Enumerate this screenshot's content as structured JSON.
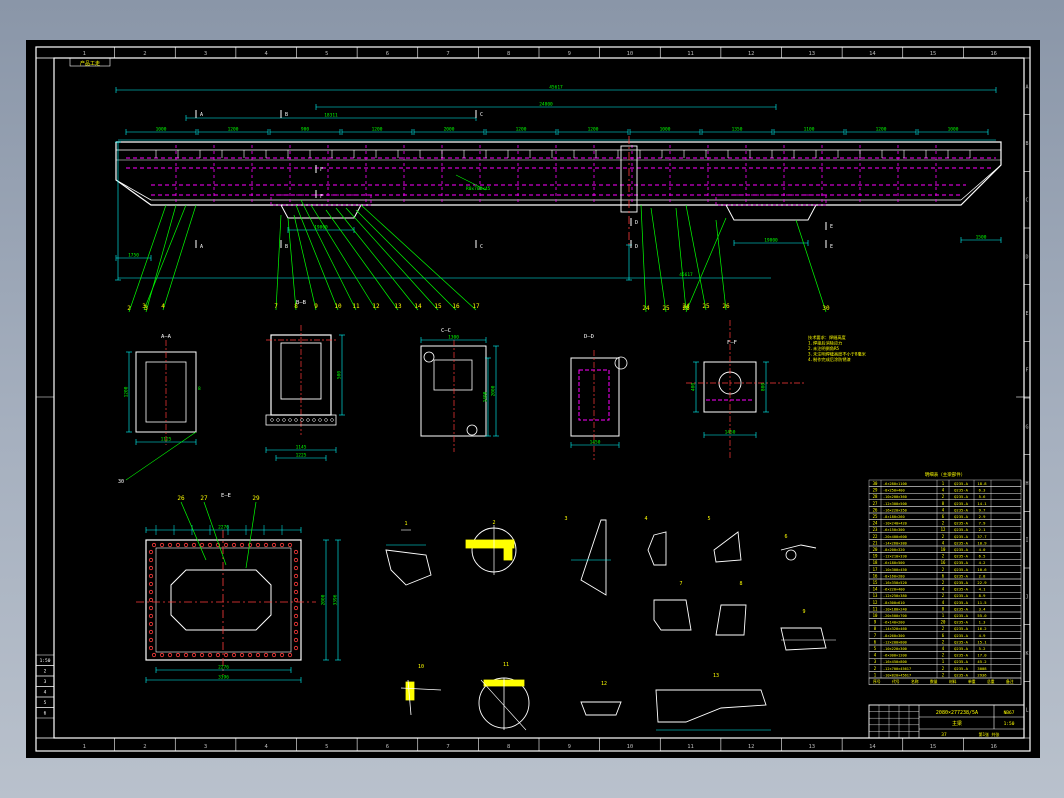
{
  "border": {
    "columns": [
      "1",
      "2",
      "3",
      "4",
      "5",
      "6",
      "7",
      "8",
      "9",
      "10",
      "11",
      "12",
      "13",
      "14",
      "15",
      "16"
    ],
    "rows": [
      "A",
      "B",
      "C",
      "D",
      "E",
      "F",
      "G",
      "H",
      "I",
      "J",
      "K",
      "L"
    ],
    "corner_tag": "产品工走"
  },
  "main_view": {
    "overall_dim": "45617",
    "mid_dim": "24800",
    "left_dim": "18311",
    "bottom_dim": "19800",
    "end_dim_left": "1750",
    "end_dim_right": "1500",
    "beam_label": "R0x700x45",
    "section_marks": [
      "A",
      "B",
      "C",
      "D",
      "E",
      "F"
    ],
    "callouts": [
      "1",
      "2",
      "3",
      "4",
      "5",
      "6",
      "7",
      "8",
      "9",
      "10",
      "11",
      "12",
      "13",
      "14",
      "15",
      "16",
      "17",
      "18",
      "19",
      "20",
      "21",
      "22",
      "23",
      "24",
      "25",
      "26",
      "27",
      "28",
      "29",
      "30"
    ],
    "top_dims": [
      "1000",
      "1200",
      "900",
      "1200",
      "2000",
      "1200",
      "1200",
      "1000",
      "1350",
      "1100",
      "1200",
      "1000"
    ]
  },
  "sections": {
    "aa": "A—A",
    "bb": "B—B",
    "dd": "D—D",
    "cc": "C—C",
    "ff": "F—F",
    "ee": "E—E",
    "aa_dims": [
      "1200",
      "1125",
      "8"
    ],
    "bb_dims": [
      "1145",
      "1225",
      "500"
    ],
    "cc_dims": [
      "3396",
      "2276",
      "2000",
      "1400",
      "1300"
    ],
    "dd_dims": [
      "1450",
      "1700"
    ],
    "ff_dims": [
      "1450",
      "800",
      "400"
    ]
  },
  "notes": [
    "技术要求：焊缝高度",
    "1.焊接后消除应力",
    "2.未注明倒角R5",
    "3.未注明焊缝高度不小于8毫米",
    "4.制作完成后涂防锈漆"
  ],
  "detail_labels": [
    "1",
    "2",
    "3",
    "4",
    "5",
    "6",
    "7",
    "8",
    "9",
    "10",
    "11",
    "12",
    "13"
  ],
  "bom": {
    "title": "明细表（主梁部件）",
    "header": [
      "序号",
      "代号",
      "名称",
      "数量",
      "材料",
      "单重",
      "总重",
      "备注"
    ],
    "rows": [
      [
        "30",
        "-6×280×1100",
        "1",
        "Q235-A",
        "18.8"
      ],
      [
        "29",
        "-8×250×400",
        "4",
        "Q235-A",
        "6.3"
      ],
      [
        "28",
        "-10×200×360",
        "2",
        "Q235-A",
        "5.6"
      ],
      [
        "27",
        "-12×300×500",
        "8",
        "Q235-A",
        "14.1"
      ],
      [
        "26",
        "-16×220×350",
        "4",
        "Q235-A",
        "9.7"
      ],
      [
        "25",
        "-8×180×260",
        "6",
        "Q235-A",
        "2.9"
      ],
      [
        "24",
        "-10×240×420",
        "2",
        "Q235-A",
        "7.9"
      ],
      [
        "23",
        "-6×150×300",
        "12",
        "Q235-A",
        "2.1"
      ],
      [
        "22",
        "-20×400×600",
        "2",
        "Q235-A",
        "37.7"
      ],
      [
        "21",
        "-14×260×380",
        "4",
        "Q235-A",
        "10.9"
      ],
      [
        "20",
        "-8×200×320",
        "10",
        "Q235-A",
        "4.0"
      ],
      [
        "19",
        "-12×210×330",
        "2",
        "Q235-A",
        "6.5"
      ],
      [
        "18",
        "-6×180×500",
        "16",
        "Q235-A",
        "4.2"
      ],
      [
        "17",
        "-10×300×450",
        "2",
        "Q235-A",
        "10.6"
      ],
      [
        "16",
        "-8×160×280",
        "6",
        "Q235-A",
        "2.8"
      ],
      [
        "15",
        "-16×350×520",
        "2",
        "Q235-A",
        "22.9"
      ],
      [
        "14",
        "-6×220×400",
        "4",
        "Q235-A",
        "4.1"
      ],
      [
        "13",
        "-12×250×380",
        "2",
        "Q235-A",
        "8.9"
      ],
      [
        "12",
        "-8×300×610",
        "4",
        "Q235-A",
        "11.5"
      ],
      [
        "11",
        "-10×180×240",
        "8",
        "Q235-A",
        "3.4"
      ],
      [
        "10",
        "-20×500×700",
        "1",
        "Q235-A",
        "55.0"
      ],
      [
        "9",
        "-6×140×200",
        "20",
        "Q235-A",
        "1.3"
      ],
      [
        "8",
        "-14×320×460",
        "2",
        "Q235-A",
        "16.2"
      ],
      [
        "7",
        "-8×260×300",
        "6",
        "Q235-A",
        "4.9"
      ],
      [
        "6",
        "-12×200×800",
        "2",
        "Q235-A",
        "15.1"
      ],
      [
        "5",
        "-10×220×300",
        "4",
        "Q235-A",
        "5.2"
      ],
      [
        "4",
        "-6×300×1200",
        "2",
        "Q235-A",
        "17.0"
      ],
      [
        "3",
        "-16×450×800",
        "1",
        "Q235-A",
        "45.2"
      ],
      [
        "2",
        "-12×700×45617",
        "2",
        "Q235-A",
        "3008"
      ],
      [
        "1",
        "-10×820×45617",
        "2",
        "Q235-A",
        "2936"
      ]
    ]
  },
  "title_block": {
    "drawing_no": "2080×277238/5A",
    "name": "主梁",
    "weight": "NB67",
    "scale": "1:50",
    "sheet": "37",
    "footer": "第1张 共张"
  },
  "left_table": [
    "1:50",
    "2",
    "3",
    "4",
    "5",
    "6"
  ],
  "colors": {
    "background": "#000000",
    "frame": "#ffffff",
    "dimension": "#00ffff",
    "hidden": "#ff00ff",
    "centerline": "#ff3b3b",
    "leader": "#00ff00",
    "text": "#ffff00",
    "weld": "#ffff00"
  }
}
